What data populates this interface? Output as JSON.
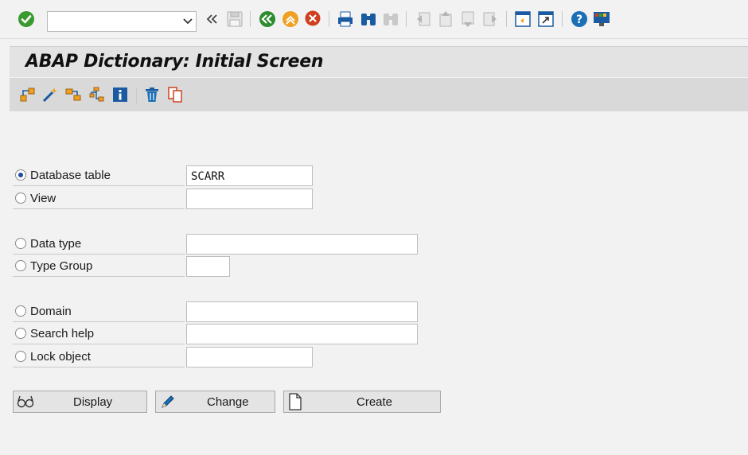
{
  "system_toolbar": {
    "command_field": {
      "value": "",
      "placeholder": ""
    },
    "icons": [
      "enter-icon",
      "expand-history-icon",
      "save-icon",
      "back-icon",
      "exit-icon",
      "cancel-icon",
      "print-icon",
      "find-icon",
      "find-next-icon",
      "first-page-icon",
      "previous-page-icon",
      "next-page-icon",
      "last-page-icon",
      "new-session-icon",
      "shortcut-icon",
      "help-icon",
      "layout-menu-icon"
    ]
  },
  "title": "ABAP Dictionary: Initial Screen",
  "app_toolbar": {
    "icons": [
      "other-object-icon",
      "magic-wand-icon",
      "where-used-icon",
      "transport-icon",
      "info-icon",
      "delete-icon",
      "copy-icon"
    ]
  },
  "form": {
    "rows": [
      {
        "label": "Database table",
        "value": "SCARR",
        "selected": true
      },
      {
        "label": "View",
        "value": "",
        "selected": false
      },
      {
        "label": "Data type",
        "value": "",
        "selected": false
      },
      {
        "label": "Type Group",
        "value": "",
        "selected": false
      },
      {
        "label": "Domain",
        "value": "",
        "selected": false
      },
      {
        "label": "Search help",
        "value": "",
        "selected": false
      },
      {
        "label": "Lock object",
        "value": "",
        "selected": false
      }
    ]
  },
  "buttons": {
    "display": "Display",
    "change": "Change",
    "create": "Create"
  },
  "colors": {
    "background": "#f2f2f2",
    "title_bar": "#e3e3e3",
    "app_toolbar": "#d9d9d9",
    "enter_green": "#3a9a2f",
    "back_green": "#2e8b2e",
    "exit_orange": "#f0a020",
    "cancel_red": "#d04020",
    "icon_blue": "#1a5aa0"
  }
}
